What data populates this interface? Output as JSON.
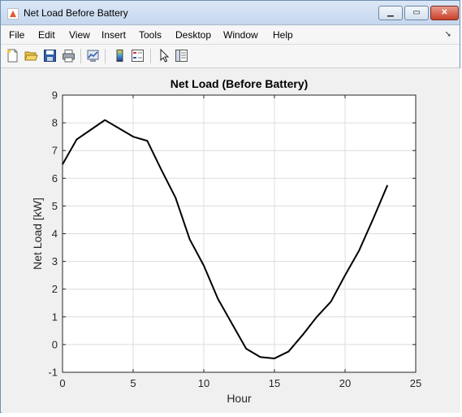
{
  "window": {
    "title": "Net Load Before Battery"
  },
  "title_buttons": {
    "minimize": "▁",
    "maximize": "▭",
    "close": "✕"
  },
  "menu": {
    "items": [
      "File",
      "Edit",
      "View",
      "Insert",
      "Tools",
      "Desktop",
      "Window",
      "Help"
    ],
    "overflow_icon": "dock-arrow-icon"
  },
  "toolbar": {
    "icons": [
      "new-figure-icon",
      "open-file-icon",
      "save-icon",
      "print-icon",
      "link-plot-icon",
      "colorbar-icon",
      "legend-icon",
      "select-pointer-icon",
      "property-inspector-icon"
    ]
  },
  "chart_data": {
    "type": "line",
    "title": "Net Load (Before Battery)",
    "xlabel": "Hour",
    "ylabel": "Net Load [kW]",
    "xlim": [
      0,
      25
    ],
    "ylim": [
      -1,
      9
    ],
    "xticks": [
      0,
      5,
      10,
      15,
      20,
      25
    ],
    "yticks": [
      -1,
      0,
      1,
      2,
      3,
      4,
      5,
      6,
      7,
      8,
      9
    ],
    "grid": true,
    "series": [
      {
        "color": "#000000",
        "x": [
          0,
          1,
          2,
          3,
          4,
          5,
          6,
          7,
          8,
          9,
          10,
          11,
          12,
          13,
          14,
          15,
          16,
          17,
          18,
          19,
          20,
          21,
          22,
          23
        ],
        "values": [
          6.5,
          7.4,
          7.75,
          8.1,
          7.8,
          7.5,
          7.35,
          6.3,
          5.3,
          3.8,
          2.85,
          1.65,
          0.75,
          -0.15,
          -0.45,
          -0.5,
          -0.25,
          0.35,
          1.0,
          1.55,
          2.5,
          3.4,
          4.55,
          5.75
        ]
      }
    ]
  }
}
